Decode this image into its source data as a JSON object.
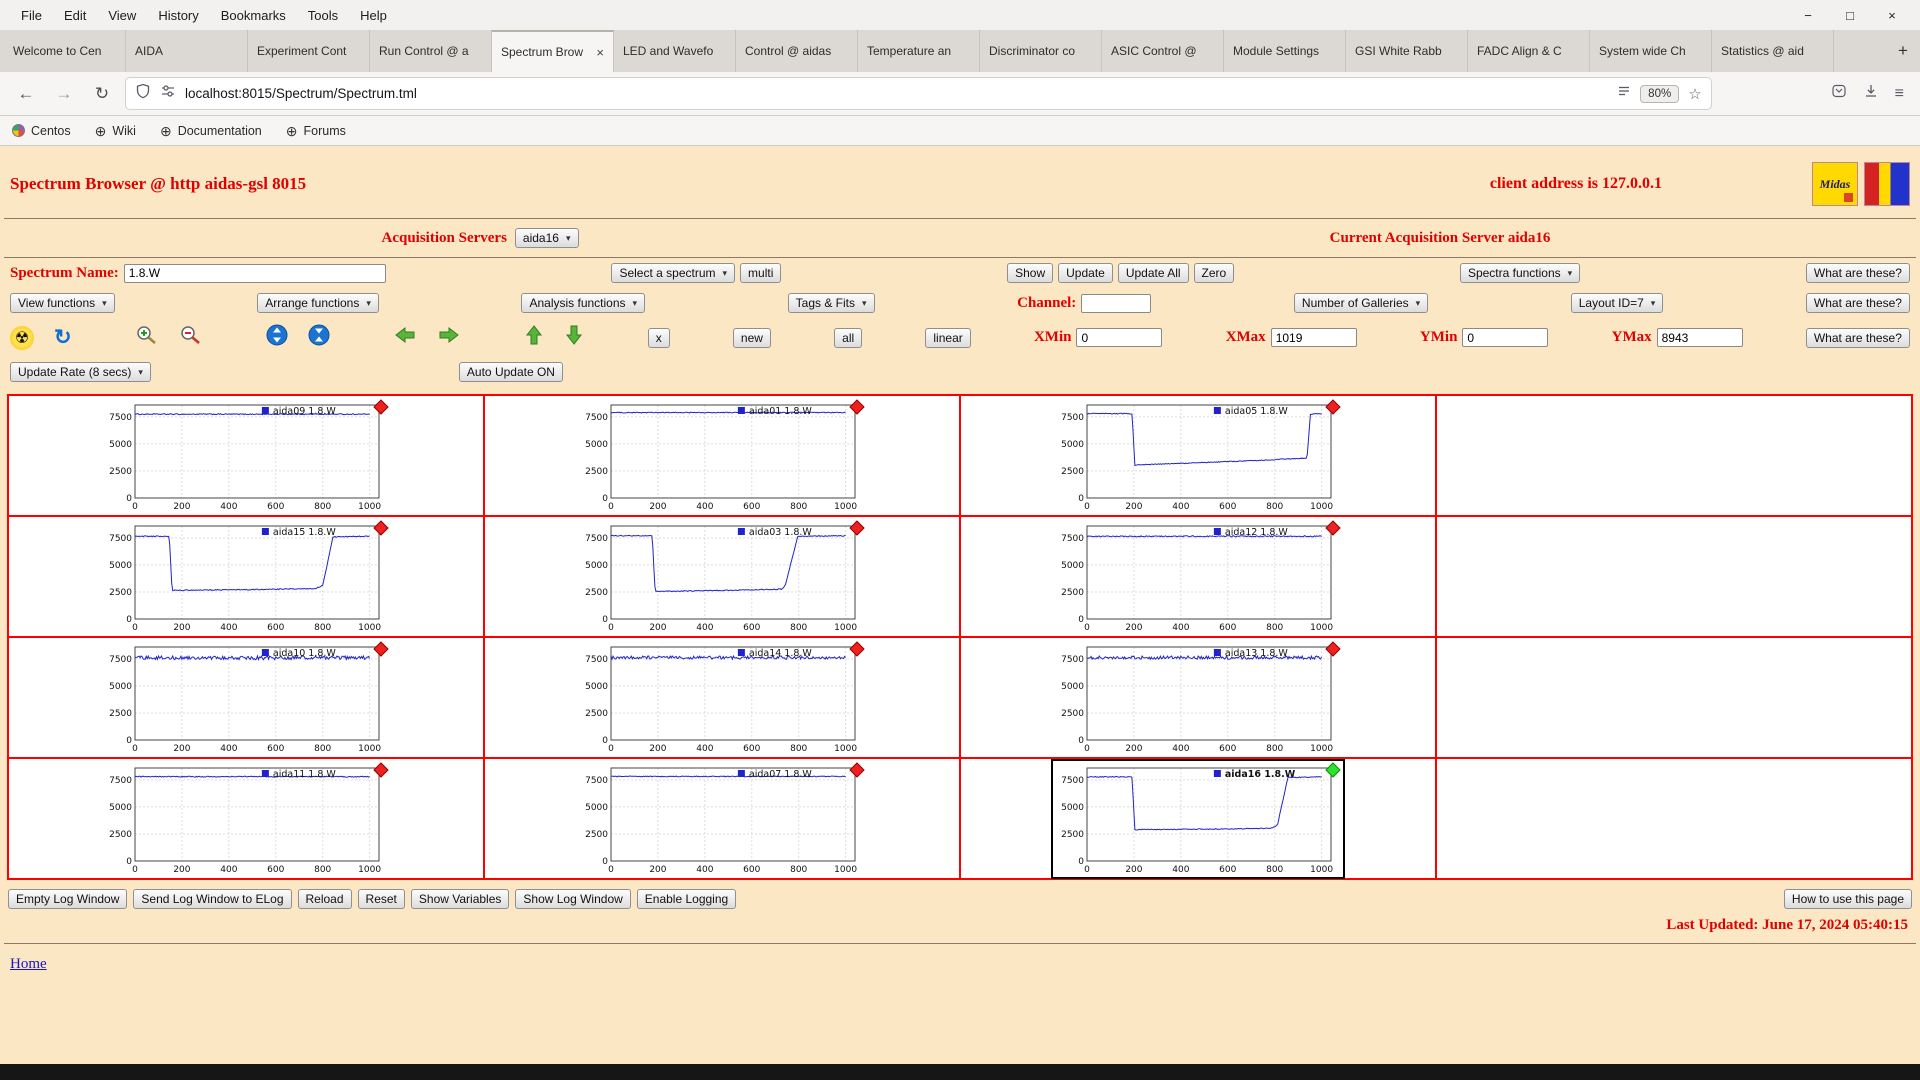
{
  "icons": {
    "back": "←",
    "forward": "→",
    "reload": "↻",
    "star": "☆",
    "menu": "≡",
    "minimize": "−",
    "maximize": "□",
    "close": "×",
    "new_tab": "+",
    "tab_close": "×",
    "select_arrow": "▾",
    "radiation": "☢",
    "refresh": "↻",
    "globe": "⊕"
  },
  "browser": {
    "menubar": [
      "File",
      "Edit",
      "View",
      "History",
      "Bookmarks",
      "Tools",
      "Help"
    ],
    "tabs": [
      {
        "label": "Welcome to Cen"
      },
      {
        "label": "AIDA"
      },
      {
        "label": "Experiment Cont"
      },
      {
        "label": "Run Control @ a"
      },
      {
        "label": "Spectrum Brow",
        "active": true
      },
      {
        "label": "LED and Wavefo"
      },
      {
        "label": "Control @ aidas"
      },
      {
        "label": "Temperature an"
      },
      {
        "label": "Discriminator co"
      },
      {
        "label": "ASIC Control @"
      },
      {
        "label": "Module Settings"
      },
      {
        "label": "GSI White Rabb"
      },
      {
        "label": "FADC Align & C"
      },
      {
        "label": "System wide Ch"
      },
      {
        "label": "Statistics @ aid"
      }
    ],
    "url": "localhost:8015/Spectrum/Spectrum.tml",
    "zoom_level": "80%",
    "bookmarks": [
      "Centos",
      "Wiki",
      "Documentation",
      "Forums"
    ]
  },
  "page": {
    "title": "Spectrum Browser @ http aidas-gsl 8015",
    "client": "client address is 127.0.0.1",
    "acquisition_label": "Acquisition Servers",
    "acquisition_server": "aida16",
    "current_server": "Current Acquisition Server aida16",
    "spectrum_name_label": "Spectrum Name:",
    "spectrum_name_value": "1.8.W",
    "select_spectrum": "Select a spectrum",
    "multi": "multi",
    "show": "Show",
    "update": "Update",
    "update_all": "Update All",
    "zero": "Zero",
    "spectra_functions": "Spectra functions",
    "what_are_these": "What are these?",
    "view_functions": "View functions",
    "arrange_functions": "Arrange functions",
    "analysis_functions": "Analysis functions",
    "tags_fits": "Tags & Fits",
    "channel_label": "Channel:",
    "channel_value": "",
    "number_of_galleries": "Number of Galleries",
    "layout_id": "Layout ID=7",
    "x_button": "x",
    "new_button": "new",
    "all_button": "all",
    "linear_button": "linear",
    "xmin_label": "XMin",
    "xmin": "0",
    "xmax_label": "XMax",
    "xmax": "1019",
    "ymin_label": "YMin",
    "ymin": "0",
    "ymax_label": "YMax",
    "ymax": "8943",
    "update_rate": "Update Rate (8 secs)",
    "auto_update": "Auto Update ON",
    "footer_buttons": [
      "Empty Log Window",
      "Send Log Window to ELog",
      "Reload",
      "Reset",
      "Show Variables",
      "Show Log Window",
      "Enable Logging"
    ],
    "how_to": "How to use this page",
    "last_updated": "Last Updated: June 17, 2024 05:40:15",
    "home": "Home"
  },
  "chart_data": {
    "type": "line",
    "title": "",
    "xlabel": "",
    "ylabel": "",
    "xlim": [
      0,
      1040
    ],
    "ylim": [
      0,
      8600
    ],
    "xticks": [
      0,
      200,
      400,
      600,
      800,
      1000
    ],
    "yticks": [
      0,
      2500,
      5000,
      7500
    ],
    "line_color": "#2222cc",
    "grid": true,
    "layout": {
      "rows": 4,
      "cols": 4,
      "empty_last_column": true
    },
    "spectra": [
      {
        "label": "aida09 1.8.W",
        "marker": "red",
        "selected": false,
        "noise": 45,
        "base": [
          [
            0,
            7750
          ],
          [
            1000,
            7750
          ]
        ]
      },
      {
        "label": "aida01 1.8.W",
        "marker": "red",
        "selected": false,
        "noise": 40,
        "base": [
          [
            0,
            7900
          ],
          [
            1000,
            7900
          ]
        ]
      },
      {
        "label": "aida05 1.8.W",
        "marker": "red",
        "selected": false,
        "noise": 40,
        "base": [
          [
            0,
            7800
          ],
          [
            192,
            7800
          ],
          [
            204,
            3050
          ],
          [
            400,
            3200
          ],
          [
            700,
            3450
          ],
          [
            900,
            3650
          ],
          [
            938,
            3700
          ],
          [
            952,
            7750
          ],
          [
            1000,
            7800
          ]
        ]
      },
      {
        "label": "aida15 1.8.W",
        "marker": "red",
        "selected": false,
        "noise": 40,
        "base": [
          [
            0,
            7650
          ],
          [
            146,
            7650
          ],
          [
            158,
            2650
          ],
          [
            500,
            2720
          ],
          [
            768,
            2820
          ],
          [
            800,
            3100
          ],
          [
            844,
            7600
          ],
          [
            1000,
            7650
          ]
        ]
      },
      {
        "label": "aida03 1.8.W",
        "marker": "red",
        "selected": false,
        "noise": 40,
        "base": [
          [
            0,
            7700
          ],
          [
            176,
            7700
          ],
          [
            188,
            2550
          ],
          [
            500,
            2650
          ],
          [
            726,
            2760
          ],
          [
            742,
            3050
          ],
          [
            796,
            7650
          ],
          [
            1000,
            7700
          ]
        ]
      },
      {
        "label": "aida12 1.8.W",
        "marker": "red",
        "selected": false,
        "noise": 55,
        "base": [
          [
            0,
            7650
          ],
          [
            1000,
            7650
          ]
        ]
      },
      {
        "label": "aida10 1.8.W",
        "marker": "red",
        "selected": false,
        "noise": 170,
        "base": [
          [
            0,
            7600
          ],
          [
            1000,
            7600
          ]
        ]
      },
      {
        "label": "aida14 1.8.W",
        "marker": "red",
        "selected": false,
        "noise": 150,
        "base": [
          [
            0,
            7620
          ],
          [
            1000,
            7620
          ]
        ]
      },
      {
        "label": "aida13 1.8.W",
        "marker": "red",
        "selected": false,
        "noise": 150,
        "base": [
          [
            0,
            7620
          ],
          [
            1000,
            7620
          ]
        ]
      },
      {
        "label": "aida11 1.8.W",
        "marker": "red",
        "selected": false,
        "noise": 45,
        "base": [
          [
            0,
            7800
          ],
          [
            1000,
            7800
          ]
        ]
      },
      {
        "label": "aida07 1.8.W",
        "marker": "red",
        "selected": false,
        "noise": 40,
        "base": [
          [
            0,
            7820
          ],
          [
            1000,
            7820
          ]
        ]
      },
      {
        "label": "aida16 1.8.W",
        "marker": "green",
        "selected": true,
        "noise": 40,
        "base": [
          [
            0,
            7780
          ],
          [
            192,
            7780
          ],
          [
            204,
            2900
          ],
          [
            600,
            2960
          ],
          [
            788,
            3040
          ],
          [
            812,
            3350
          ],
          [
            856,
            7720
          ],
          [
            1000,
            7780
          ]
        ]
      }
    ]
  }
}
